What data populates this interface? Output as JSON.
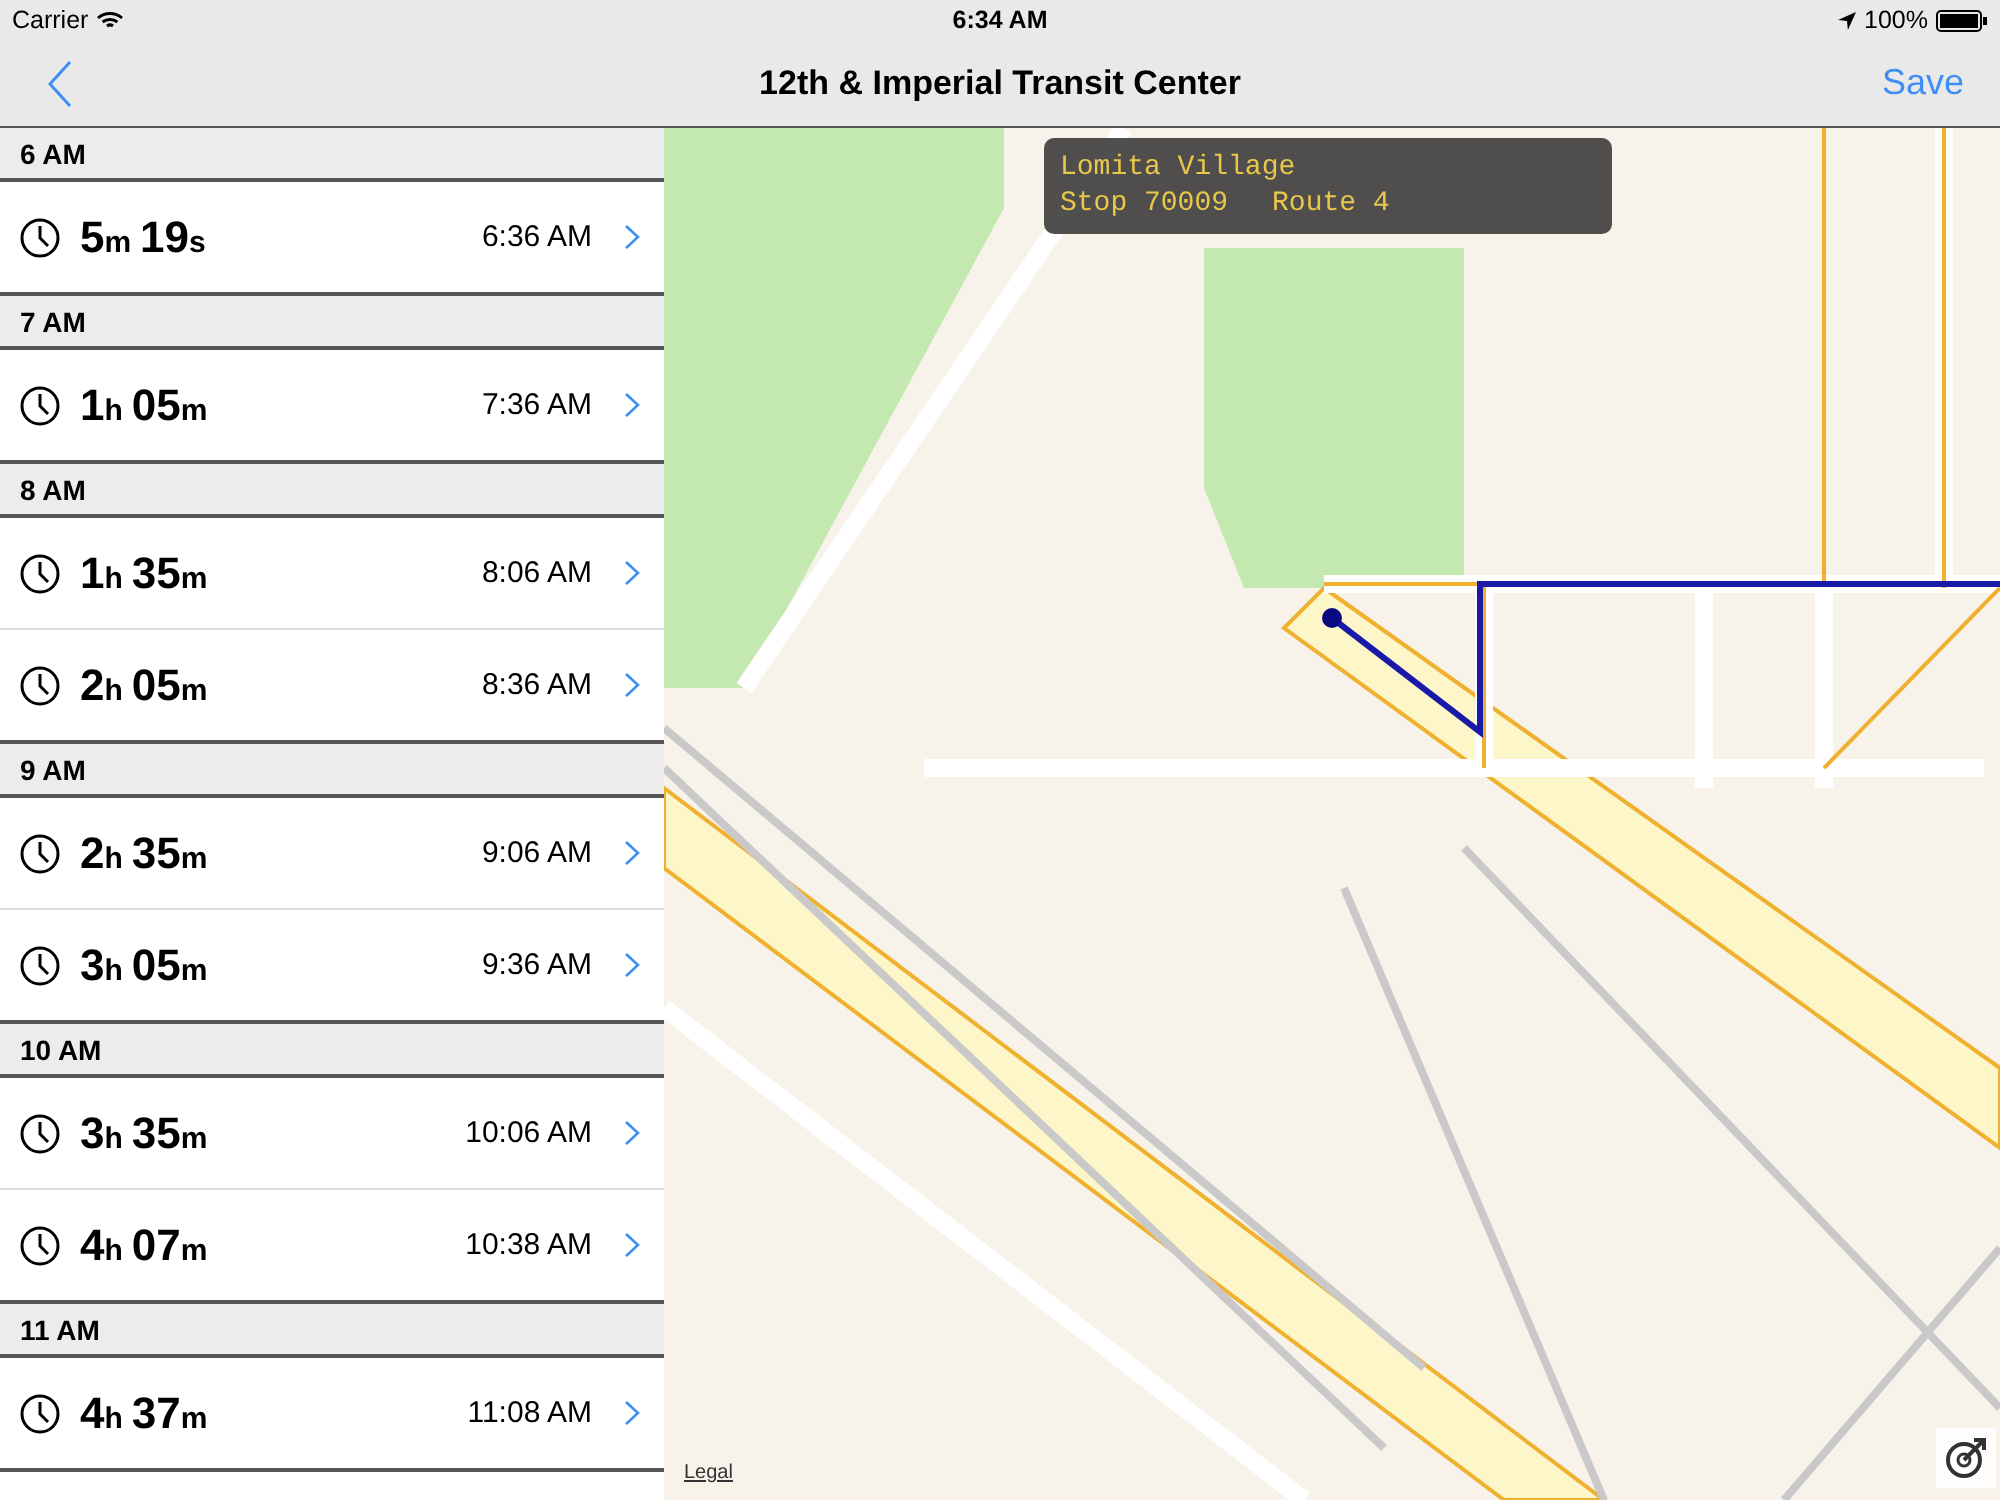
{
  "status_bar": {
    "carrier": "Carrier",
    "time": "6:34 AM",
    "battery": "100%"
  },
  "nav": {
    "title": "12th & Imperial Transit Center",
    "save": "Save"
  },
  "sections": [
    {
      "header": "6 AM",
      "rows": [
        {
          "duration": [
            {
              "value": "5",
              "unit": "m"
            },
            {
              "value": "19",
              "unit": "s"
            }
          ],
          "time": "6:36 AM"
        }
      ]
    },
    {
      "header": "7 AM",
      "rows": [
        {
          "duration": [
            {
              "value": "1",
              "unit": "h"
            },
            {
              "value": "05",
              "unit": "m"
            }
          ],
          "time": "7:36 AM"
        }
      ]
    },
    {
      "header": "8 AM",
      "rows": [
        {
          "duration": [
            {
              "value": "1",
              "unit": "h"
            },
            {
              "value": "35",
              "unit": "m"
            }
          ],
          "time": "8:06 AM"
        },
        {
          "duration": [
            {
              "value": "2",
              "unit": "h"
            },
            {
              "value": "05",
              "unit": "m"
            }
          ],
          "time": "8:36 AM"
        }
      ]
    },
    {
      "header": "9 AM",
      "rows": [
        {
          "duration": [
            {
              "value": "2",
              "unit": "h"
            },
            {
              "value": "35",
              "unit": "m"
            }
          ],
          "time": "9:06 AM"
        },
        {
          "duration": [
            {
              "value": "3",
              "unit": "h"
            },
            {
              "value": "05",
              "unit": "m"
            }
          ],
          "time": "9:36 AM"
        }
      ]
    },
    {
      "header": "10 AM",
      "rows": [
        {
          "duration": [
            {
              "value": "3",
              "unit": "h"
            },
            {
              "value": "35",
              "unit": "m"
            }
          ],
          "time": "10:06 AM"
        },
        {
          "duration": [
            {
              "value": "4",
              "unit": "h"
            },
            {
              "value": "07",
              "unit": "m"
            }
          ],
          "time": "10:38 AM"
        }
      ]
    },
    {
      "header": "11 AM",
      "rows": [
        {
          "duration": [
            {
              "value": "4",
              "unit": "h"
            },
            {
              "value": "37",
              "unit": "m"
            }
          ],
          "time": "11:08 AM"
        }
      ]
    }
  ],
  "map": {
    "kind": "picture",
    "callout": {
      "name": "Lomita Village",
      "stop": "Stop 70009",
      "route": "Route 4"
    },
    "legal": "Legal"
  }
}
